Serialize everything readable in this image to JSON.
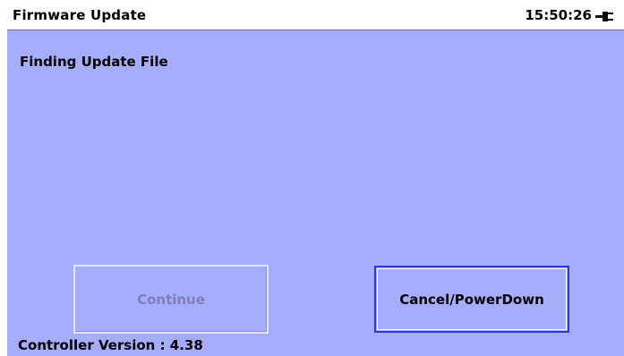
{
  "window": {
    "title": "Firmware Update",
    "time": "15:50:26",
    "power_icon": "plug-icon"
  },
  "main": {
    "status": "Finding Update File"
  },
  "buttons": {
    "continue_label": "Continue",
    "continue_enabled": false,
    "cancel_label": "Cancel/PowerDown"
  },
  "footer": {
    "version": "Controller Version : 4.38"
  },
  "colors": {
    "background": "#a6adfc",
    "titlebar": "#ffffff",
    "focus_border": "#2c3ad8",
    "disabled_text": "#7c80b8"
  }
}
